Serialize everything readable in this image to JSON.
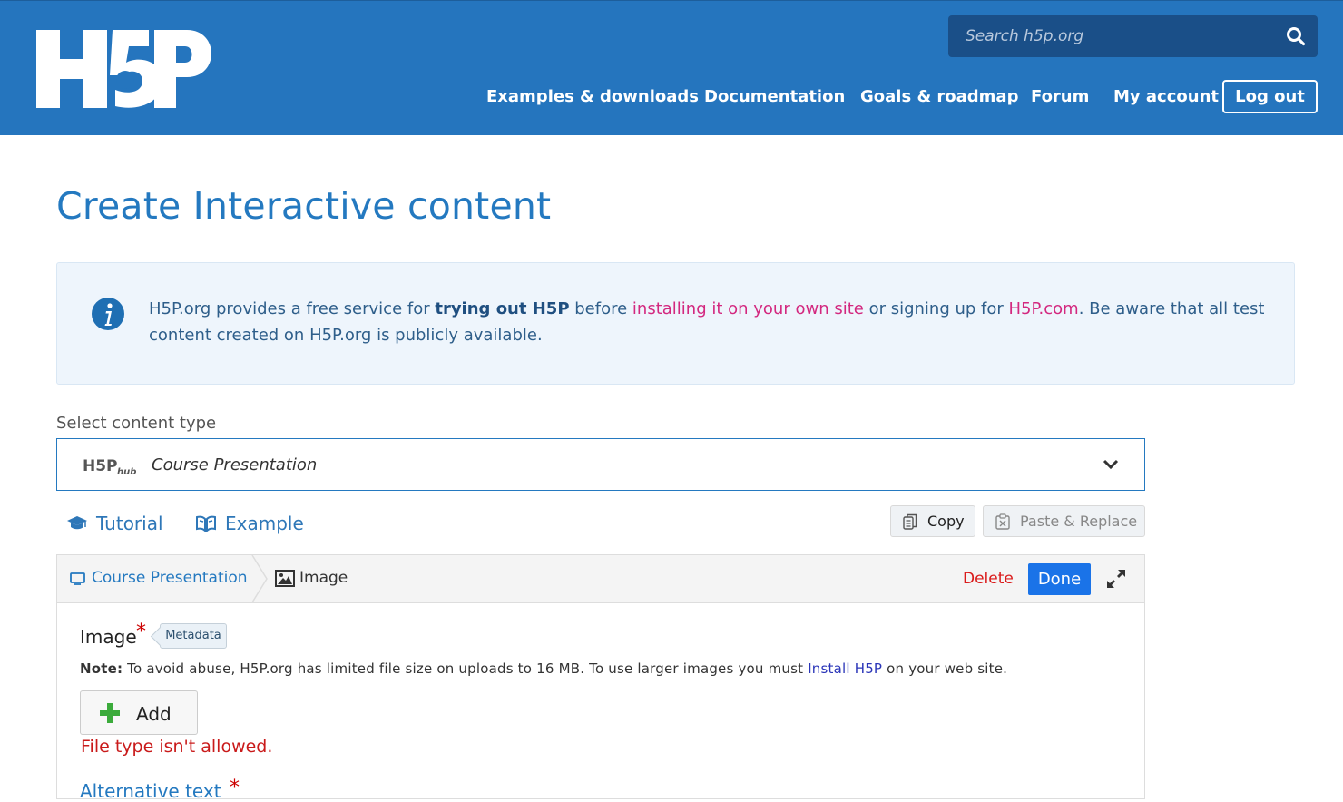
{
  "header": {
    "logo_text": "H5P",
    "search": {
      "placeholder": "Search h5p.org"
    },
    "nav": [
      {
        "label": "Examples & downloads"
      },
      {
        "label": "Documentation"
      },
      {
        "label": "Goals & roadmap"
      },
      {
        "label": "Forum"
      },
      {
        "label": "My account"
      }
    ],
    "logout_label": "Log out"
  },
  "page": {
    "title": "Create Interactive content"
  },
  "info": {
    "text_1": "H5P.org provides a free service for ",
    "bold": "trying out H5P",
    "text_2": " before ",
    "link_1": "installing it on your own site",
    "text_3": " or signing up for ",
    "link_2": "H5P.com",
    "text_4": ". Be aware that all test content created on H5P.org is publicly available."
  },
  "selector": {
    "label": "Select content type",
    "hub_logo_text": "H5P hub",
    "value": "Course Presentation"
  },
  "links": {
    "tutorial": "Tutorial",
    "example": "Example"
  },
  "actions": {
    "copy": "Copy",
    "paste": "Paste & Replace"
  },
  "editor": {
    "breadcrumb": [
      "Course Presentation",
      "Image"
    ],
    "delete_label": "Delete",
    "done_label": "Done",
    "field": {
      "label": "Image",
      "required_mark": "*",
      "metadata_label": "Metadata",
      "note_label": "Note:",
      "note_text": " To avoid abuse, H5P.org has limited file size on uploads to 16 MB. To use larger images you must ",
      "note_link": "Install H5P",
      "note_end": " on your web site.",
      "add_label": "Add",
      "error": "File type isn't allowed."
    },
    "next_field": {
      "label": "Alternative text",
      "required_mark": "*"
    }
  },
  "colors": {
    "header_bg": "#2575be",
    "accent": "#2479c0",
    "link_pink": "#d3287f",
    "done_blue": "#1a73e8",
    "error_red": "#c91a1a"
  }
}
